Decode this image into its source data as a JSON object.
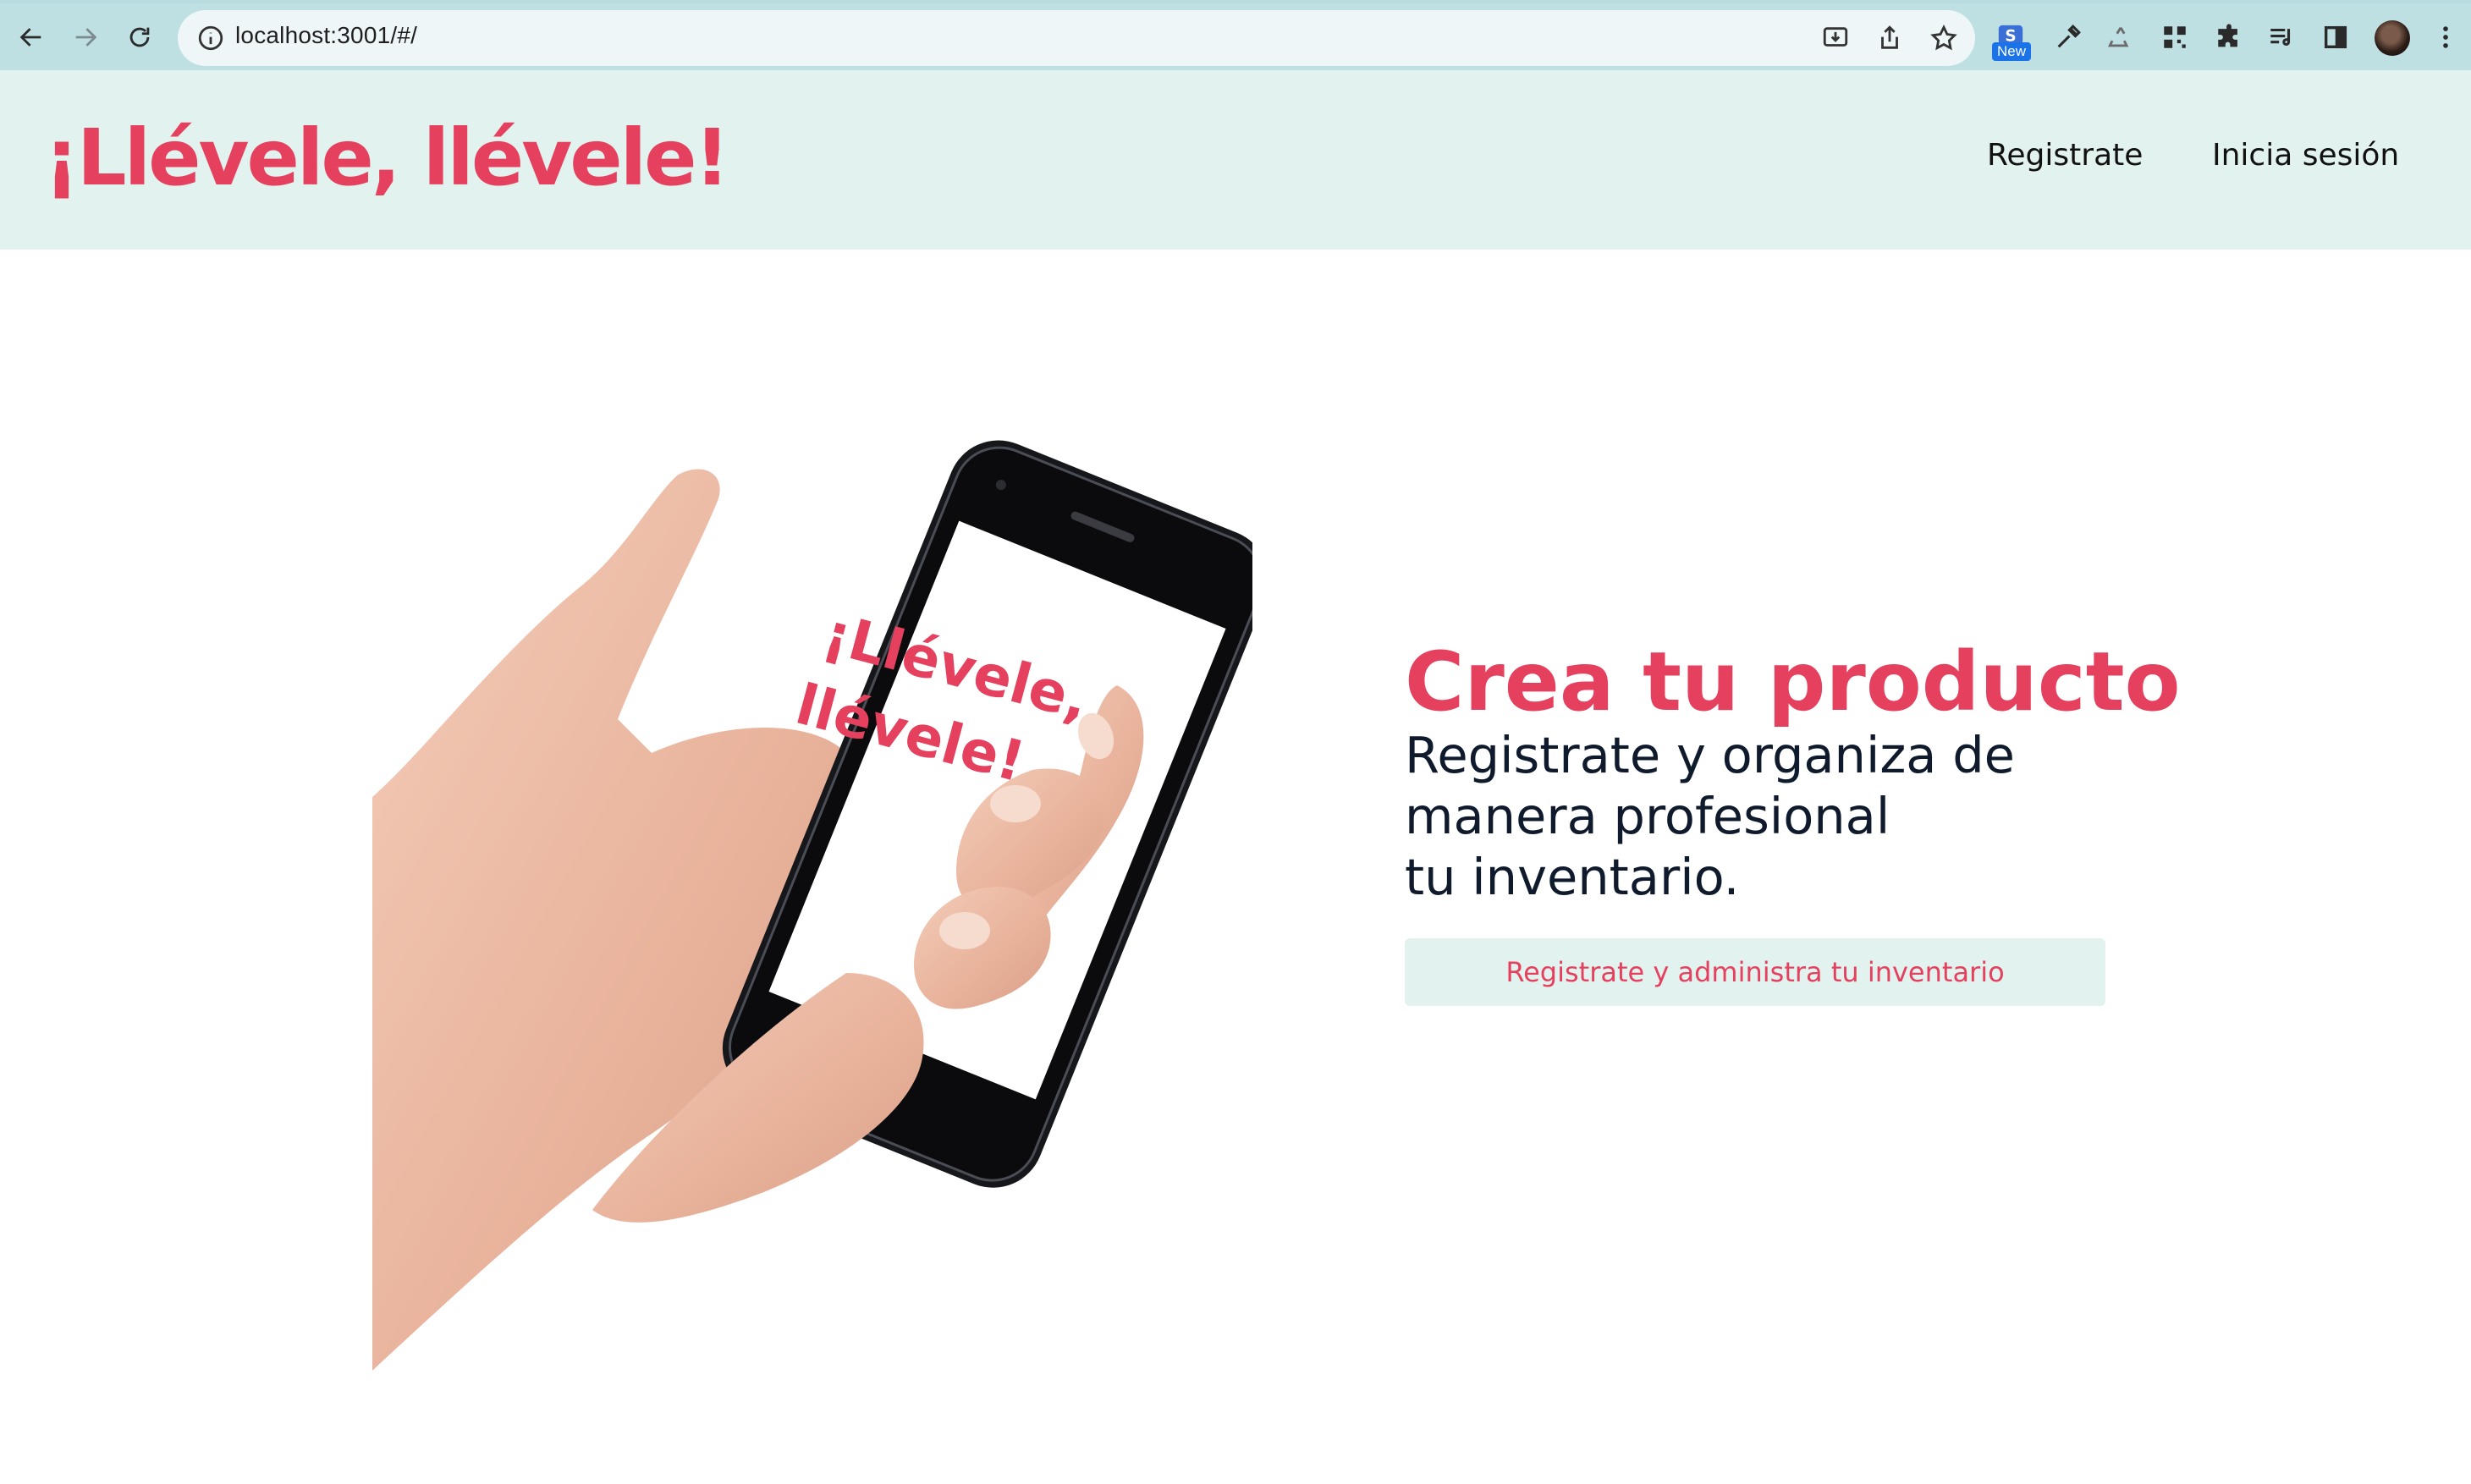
{
  "browser": {
    "url": "localhost:3001/#/",
    "new_badge": "New"
  },
  "header": {
    "logo": "¡Llévele, llévele!",
    "nav": [
      {
        "label": "Registrate"
      },
      {
        "label": "Inicia sesión"
      }
    ]
  },
  "hero": {
    "phone_logo_line1": "¡Llévele,",
    "phone_logo_line2": "llévele!",
    "title": "Crea tu producto",
    "subtitle_lines": [
      "Registrate y organiza de",
      "manera profesional",
      "tu inventario."
    ],
    "cta": "Registrate y administra tu inventario"
  },
  "colors": {
    "brand": "#e5415f",
    "header_bg": "#e2f3ef",
    "text_dark": "#0f1b2d"
  }
}
